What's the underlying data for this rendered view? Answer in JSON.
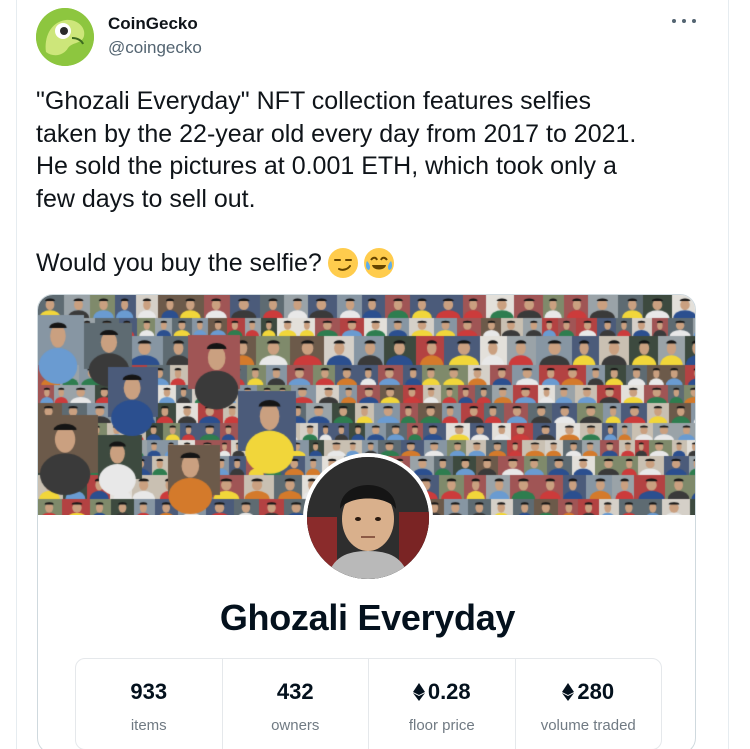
{
  "author": {
    "display_name": "CoinGecko",
    "handle": "@coingecko",
    "avatar_icon": "coingecko-logo-icon"
  },
  "tweet": {
    "text": "\"Ghozali Everyday\" NFT collection features selfies\ntaken by the 22-year old every day from 2017 to 2021.\nHe sold the pictures at 0.001 ETH, which took only a\nfew days to sell out.",
    "question": "Would you buy the selfie?",
    "emojis": [
      "smirking-face-icon",
      "face-with-tears-of-joy-icon"
    ]
  },
  "card": {
    "collection_name": "Ghozali Everyday",
    "stats": [
      {
        "value": "933",
        "label": "items",
        "icon": ""
      },
      {
        "value": "432",
        "label": "owners",
        "icon": ""
      },
      {
        "value": "0.28",
        "label": "floor price",
        "icon": "ethereum-icon"
      },
      {
        "value": "280",
        "label": "volume traded",
        "icon": "ethereum-icon"
      }
    ]
  },
  "colors": {
    "text_primary": "#0f1419",
    "text_secondary": "#536471",
    "brand_green": "#8dc63f",
    "opensea_dark": "#04111d",
    "stat_label": "#707a83"
  }
}
